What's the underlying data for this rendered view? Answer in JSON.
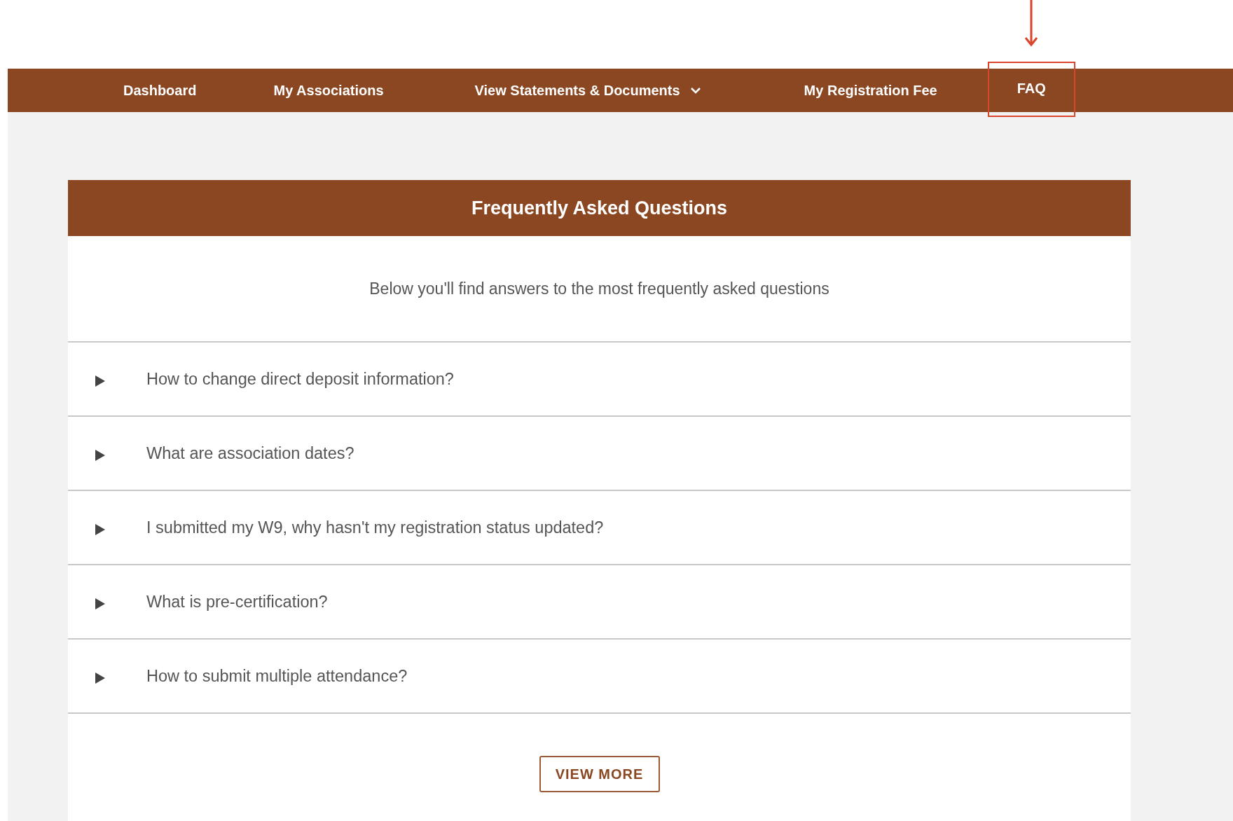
{
  "nav": {
    "items": [
      {
        "label": "Dashboard",
        "dropdown": false,
        "highlighted": false
      },
      {
        "label": "My Associations",
        "dropdown": false,
        "highlighted": false
      },
      {
        "label": "View Statements & Documents",
        "dropdown": true,
        "highlighted": false
      },
      {
        "label": "My Registration Fee",
        "dropdown": false,
        "highlighted": false
      },
      {
        "label": "FAQ",
        "dropdown": false,
        "highlighted": true
      }
    ]
  },
  "faq": {
    "title": "Frequently Asked Questions",
    "intro": "Below you'll find answers to the most frequently asked questions",
    "questions": [
      {
        "text": "How to change direct deposit information?",
        "expanded": false
      },
      {
        "text": "What are association dates?",
        "expanded": false
      },
      {
        "text": "I submitted my W9, why hasn't my registration status updated?",
        "expanded": false
      },
      {
        "text": "What is pre-certification?",
        "expanded": false
      },
      {
        "text": "How to submit multiple attendance?",
        "expanded": false
      }
    ],
    "button": "VIEW MORE"
  }
}
